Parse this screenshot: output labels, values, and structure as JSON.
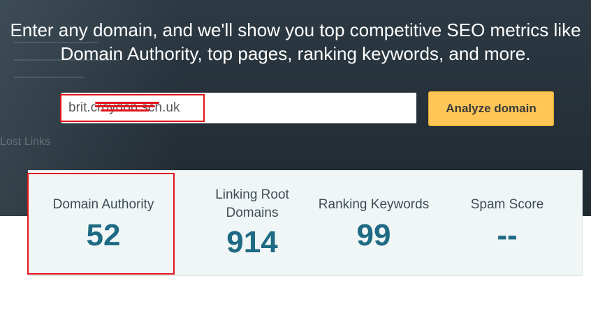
{
  "hero": {
    "headline_line1": "Enter any domain, and we'll show you top competitive SEO metrics like",
    "headline_line2": "Domain Authority, top pages, ranking keywords, and more.",
    "background_ghost_text": "Lost Links"
  },
  "search": {
    "value": "brit.croydon.sch.uk",
    "button_label": "Analyze domain"
  },
  "metrics": [
    {
      "label": "Domain Authority",
      "value": "52"
    },
    {
      "label": "Linking Root Domains",
      "value": "914"
    },
    {
      "label": "Ranking Keywords",
      "value": "99"
    },
    {
      "label": "Spam Score",
      "value": "--"
    }
  ],
  "colors": {
    "accent": "#1f6a85",
    "button": "#fdc656",
    "highlight": "#e0141a",
    "hero_bg": "#253039"
  }
}
